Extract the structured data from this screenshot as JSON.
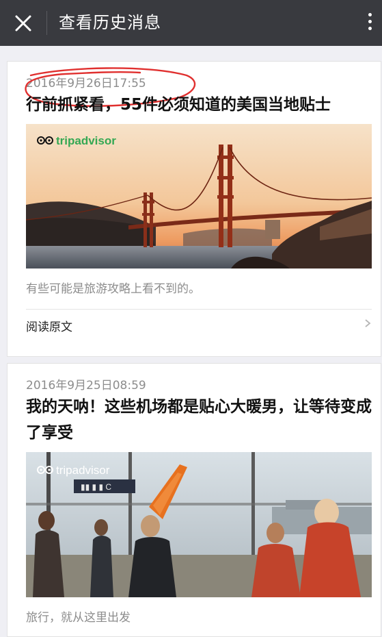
{
  "header": {
    "title": "查看历史消息",
    "close_icon": "close-icon",
    "more_icon": "more-vertical-icon"
  },
  "articles": [
    {
      "date": "2016年9月26日17:55",
      "title": "行前抓紧看，55件必须知道的美国当地贴士",
      "brand": "tripadvisor",
      "image": "golden-gate-bridge-sunset",
      "summary": "有些可能是旅游攻略上看不到的。",
      "read_more": "阅读原文",
      "annotation": "red-hand-drawn-circle"
    },
    {
      "date": "2016年9月25日08:59",
      "title": "我的天呐！这些机场都是贴心大暖男，让等待变成了享受",
      "brand": "tripadvisor",
      "image": "airport-terminal-travelers",
      "summary": "旅行，就从这里出发"
    }
  ],
  "colors": {
    "header_bg": "#393a3f",
    "page_bg": "#efeff4",
    "card_bg": "#ffffff",
    "annotation": "#e0302f",
    "brand_green": "#34a853"
  }
}
